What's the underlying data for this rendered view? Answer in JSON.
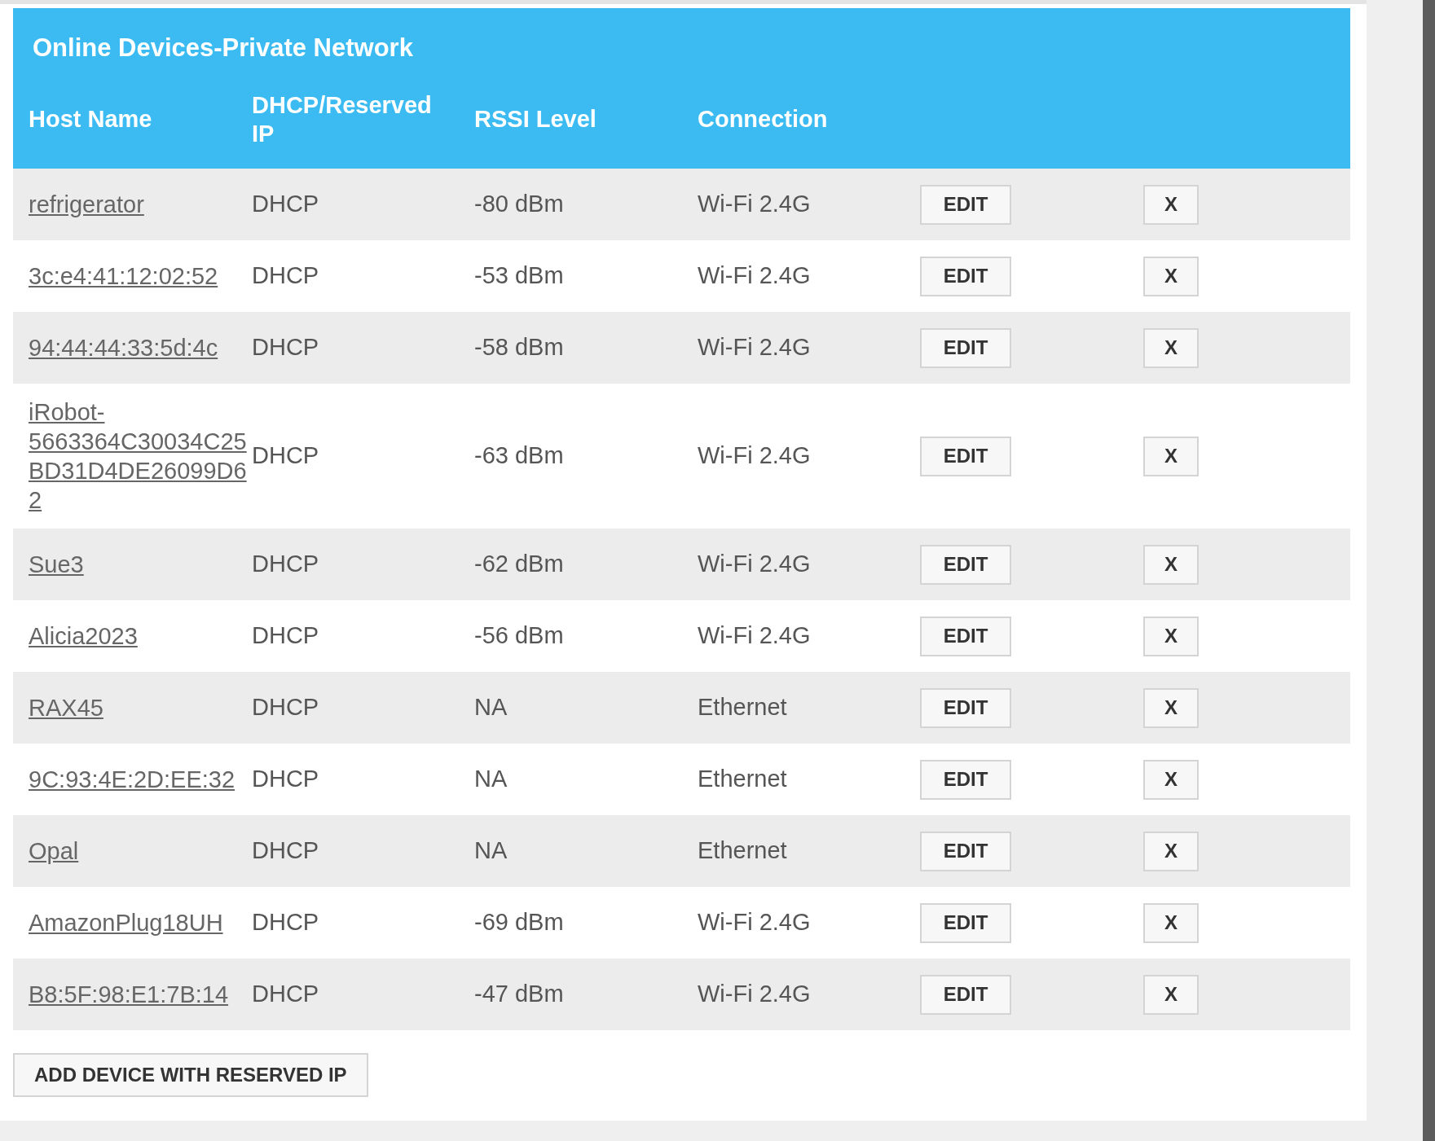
{
  "title": "Online Devices-Private Network",
  "columns": [
    "Host Name",
    "DHCP/Reserved IP",
    "RSSI Level",
    "Connection"
  ],
  "rows": [
    {
      "host": "refrigerator",
      "ip": "DHCP",
      "rssi": "-80 dBm",
      "connection": "Wi-Fi 2.4G",
      "edit": "EDIT",
      "remove": "X"
    },
    {
      "host": "3c:e4:41:12:02:52",
      "ip": "DHCP",
      "rssi": "-53 dBm",
      "connection": "Wi-Fi 2.4G",
      "edit": "EDIT",
      "remove": "X"
    },
    {
      "host": "94:44:44:33:5d:4c",
      "ip": "DHCP",
      "rssi": "-58 dBm",
      "connection": "Wi-Fi 2.4G",
      "edit": "EDIT",
      "remove": "X"
    },
    {
      "host": "iRobot-5663364C30034C25BD31D4DE26099D62",
      "ip": "DHCP",
      "rssi": "-63 dBm",
      "connection": "Wi-Fi 2.4G",
      "edit": "EDIT",
      "remove": "X"
    },
    {
      "host": "Sue3",
      "ip": "DHCP",
      "rssi": "-62 dBm",
      "connection": "Wi-Fi 2.4G",
      "edit": "EDIT",
      "remove": "X"
    },
    {
      "host": "Alicia2023",
      "ip": "DHCP",
      "rssi": "-56 dBm",
      "connection": "Wi-Fi 2.4G",
      "edit": "EDIT",
      "remove": "X"
    },
    {
      "host": "RAX45",
      "ip": "DHCP",
      "rssi": "NA",
      "connection": "Ethernet",
      "edit": "EDIT",
      "remove": "X"
    },
    {
      "host": "9C:93:4E:2D:EE:32",
      "ip": "DHCP",
      "rssi": "NA",
      "connection": "Ethernet",
      "edit": "EDIT",
      "remove": "X"
    },
    {
      "host": "Opal",
      "ip": "DHCP",
      "rssi": "NA",
      "connection": "Ethernet",
      "edit": "EDIT",
      "remove": "X"
    },
    {
      "host": "AmazonPlug18UH",
      "ip": "DHCP",
      "rssi": "-69 dBm",
      "connection": "Wi-Fi 2.4G",
      "edit": "EDIT",
      "remove": "X"
    },
    {
      "host": "B8:5F:98:E1:7B:14",
      "ip": "DHCP",
      "rssi": "-47 dBm",
      "connection": "Wi-Fi 2.4G",
      "edit": "EDIT",
      "remove": "X"
    }
  ],
  "add_button": "ADD DEVICE WITH RESERVED IP"
}
